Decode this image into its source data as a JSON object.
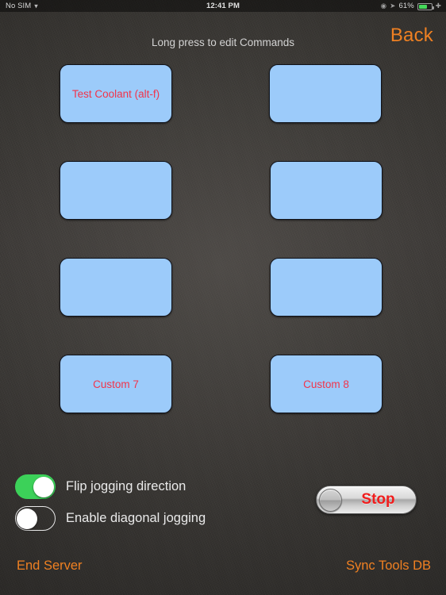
{
  "statusbar": {
    "carrier": "No SIM",
    "wifi_icon": "wifi-icon",
    "time": "12:41 PM",
    "location_icon": "location-arrow-icon",
    "alarm_icon": "alarm-icon",
    "battery_percent": "61%",
    "battery_icon": "battery-icon",
    "charging_icon": "bluetooth-icon"
  },
  "header": {
    "hint": "Long press to edit Commands",
    "back_label": "Back"
  },
  "commands": {
    "rows": [
      {
        "left": {
          "label": "Test Coolant (alt-f)"
        },
        "right": {
          "label": ""
        }
      },
      {
        "left": {
          "label": ""
        },
        "right": {
          "label": ""
        }
      },
      {
        "left": {
          "label": ""
        },
        "right": {
          "label": ""
        }
      },
      {
        "left": {
          "label": "Custom 7"
        },
        "right": {
          "label": "Custom 8"
        }
      }
    ]
  },
  "settings": {
    "toggles": [
      {
        "label": "Flip jogging direction",
        "state": "on"
      },
      {
        "label": "Enable diagonal jogging",
        "state": "off"
      }
    ]
  },
  "stop": {
    "label": "Stop"
  },
  "footer": {
    "end_server_label": "End Server",
    "sync_tools_label": "Sync Tools DB"
  },
  "colors": {
    "accent_orange": "#ef8022",
    "button_blue": "#9ccbfa",
    "button_text_red": "#f2344a",
    "stop_red": "#f01d1d",
    "toggle_green": "#3cd159",
    "battery_green": "#45d85a"
  }
}
